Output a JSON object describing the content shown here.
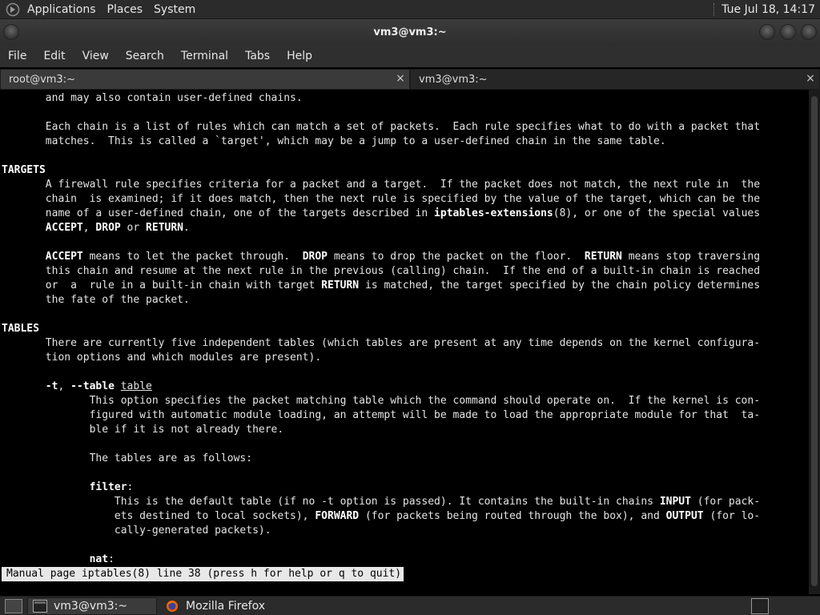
{
  "top_panel": {
    "menus": [
      "Applications",
      "Places",
      "System"
    ],
    "clock": "Tue Jul 18, 14:17"
  },
  "window": {
    "title": "vm3@vm3:~"
  },
  "menubar": {
    "items": [
      "File",
      "Edit",
      "View",
      "Search",
      "Terminal",
      "Tabs",
      "Help"
    ]
  },
  "tabs": [
    {
      "label": "root@vm3:~",
      "close": "×"
    },
    {
      "label": "vm3@vm3:~",
      "close": "×"
    }
  ],
  "terminal": {
    "lines": [
      [
        {
          "t": "       and may also contain user-defined chains."
        }
      ],
      [],
      [
        {
          "t": "       Each chain is a list of rules which can match a set of packets.  Each rule specifies what to do with a packet that"
        }
      ],
      [
        {
          "t": "       matches.  This is called a `target', which may be a jump to a user-defined chain in the same table."
        }
      ],
      [],
      [
        {
          "t": "TARGETS",
          "s": "b"
        }
      ],
      [
        {
          "t": "       A firewall rule specifies criteria for a packet and a target.  If the packet does not match, the next rule in  the"
        }
      ],
      [
        {
          "t": "       chain  is examined; if it does match, then the next rule is specified by the value of the target, which can be the"
        }
      ],
      [
        {
          "t": "       name of a user-defined chain, one of the targets described in "
        },
        {
          "t": "iptables-extensions",
          "s": "b"
        },
        {
          "t": "(8), or one of the special values"
        }
      ],
      [
        {
          "t": "       "
        },
        {
          "t": "ACCEPT",
          "s": "b"
        },
        {
          "t": ", "
        },
        {
          "t": "DROP",
          "s": "b"
        },
        {
          "t": " or "
        },
        {
          "t": "RETURN",
          "s": "b"
        },
        {
          "t": "."
        }
      ],
      [],
      [
        {
          "t": "       "
        },
        {
          "t": "ACCEPT",
          "s": "b"
        },
        {
          "t": " means to let the packet through.  "
        },
        {
          "t": "DROP",
          "s": "b"
        },
        {
          "t": " means to drop the packet on the floor.  "
        },
        {
          "t": "RETURN",
          "s": "b"
        },
        {
          "t": " means stop traversing"
        }
      ],
      [
        {
          "t": "       this chain and resume at the next rule in the previous (calling) chain.  If the end of a built-in chain is reached"
        }
      ],
      [
        {
          "t": "       or  a  rule in a built-in chain with target "
        },
        {
          "t": "RETURN",
          "s": "b"
        },
        {
          "t": " is matched, the target specified by the chain policy determines"
        }
      ],
      [
        {
          "t": "       the fate of the packet."
        }
      ],
      [],
      [
        {
          "t": "TABLES",
          "s": "b"
        }
      ],
      [
        {
          "t": "       There are currently five independent tables (which tables are present at any time depends on the kernel configura-"
        }
      ],
      [
        {
          "t": "       tion options and which modules are present)."
        }
      ],
      [],
      [
        {
          "t": "       "
        },
        {
          "t": "-t",
          "s": "b"
        },
        {
          "t": ", "
        },
        {
          "t": "--table",
          "s": "b"
        },
        {
          "t": " "
        },
        {
          "t": "table",
          "s": "u"
        }
      ],
      [
        {
          "t": "              This option specifies the packet matching table which the command should operate on.  If the kernel is con-"
        }
      ],
      [
        {
          "t": "              figured with automatic module loading, an attempt will be made to load the appropriate module for that  ta-"
        }
      ],
      [
        {
          "t": "              ble if it is not already there."
        }
      ],
      [],
      [
        {
          "t": "              The tables are as follows:"
        }
      ],
      [],
      [
        {
          "t": "              "
        },
        {
          "t": "filter",
          "s": "b"
        },
        {
          "t": ":"
        }
      ],
      [
        {
          "t": "                  This is the default table (if no -t option is passed). It contains the built-in chains "
        },
        {
          "t": "INPUT",
          "s": "b"
        },
        {
          "t": " (for pack-"
        }
      ],
      [
        {
          "t": "                  ets destined to local sockets), "
        },
        {
          "t": "FORWARD",
          "s": "b"
        },
        {
          "t": " (for packets being routed through the box), and "
        },
        {
          "t": "OUTPUT",
          "s": "b"
        },
        {
          "t": " (for lo-"
        }
      ],
      [
        {
          "t": "                  cally-generated packets)."
        }
      ],
      [],
      [
        {
          "t": "              "
        },
        {
          "t": "nat",
          "s": "b"
        },
        {
          "t": ":"
        }
      ]
    ],
    "status": "Manual page iptables(8) line 38 (press h for help or q to quit)"
  },
  "taskbar": {
    "tasks": [
      "vm3@vm3:~",
      "Mozilla Firefox"
    ]
  }
}
